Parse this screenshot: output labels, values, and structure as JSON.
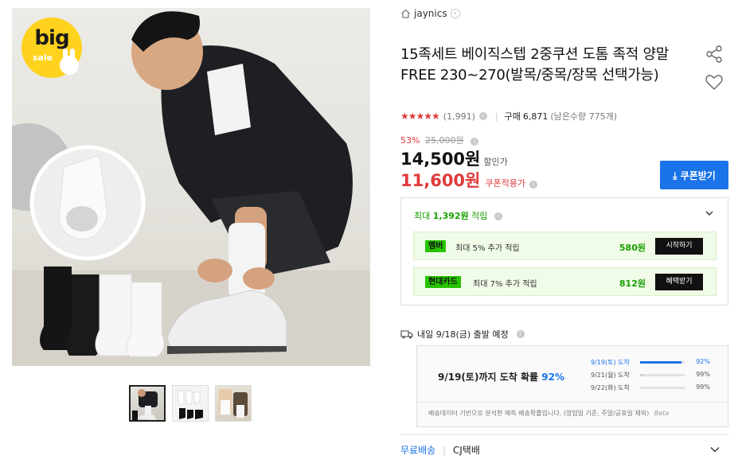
{
  "badge": {
    "line1": "big",
    "line2": "sale"
  },
  "seller": {
    "name": "jaynics"
  },
  "product": {
    "title": "15족세트 베이직스텝 2중쿠션 도톰 족적 양말 FREE 230~270(발목/중목/장목 선택가능)"
  },
  "rating": {
    "stars": "★★★★★",
    "review_count": "(1,991)",
    "purchase_label": "구매",
    "purchase_count": "6,871",
    "stock": "(남은수량 775개)"
  },
  "price": {
    "discount_rate": "53%",
    "original": "25,000원",
    "sale": "14,500원",
    "sale_label": "할인가",
    "coupon_price": "11,600원",
    "coupon_label": "쿠폰적용가",
    "coupon_button": "쿠폰받기"
  },
  "points": {
    "header_prefix": "최대",
    "header_value": "1,392원",
    "header_suffix": "적립",
    "rows": [
      {
        "tag": "멤버",
        "desc": "최대 5% 추가 적립",
        "amount": "580원",
        "action": "시작하기"
      },
      {
        "tag": "현대카드",
        "desc": "최대 7% 추가 적립",
        "amount": "812원",
        "action": "혜택받기"
      }
    ]
  },
  "shipping": {
    "header": "내일 9/18(금) 출발 예정",
    "probability_text": "9/19(토)까지 도착 확률",
    "probability_value": "92%",
    "distribution": [
      {
        "label": "9/19(토) 도착",
        "pct": "92%",
        "value": 0.92
      },
      {
        "label": "9/21(월) 도착",
        "pct": "99%",
        "value": 0.07
      },
      {
        "label": "9/22(화) 도착",
        "pct": "99%",
        "value": 0.0
      }
    ],
    "note": "배송데이터 기반으로 분석한 예측 배송확률입니다. (영업일 기준, 주말/공휴일 제외)",
    "beta": "Beta",
    "free_label": "무료배송",
    "carrier": "CJ택배"
  },
  "colors": {
    "accent_blue": "#1a73e8",
    "price_red": "#e03a3a",
    "point_green": "#18a000",
    "tag_green": "#27c400"
  },
  "icons": [
    "home-icon",
    "chevron-right-icon",
    "share-icon",
    "heart-icon",
    "info-icon",
    "download-icon",
    "chevron-down-icon",
    "truck-icon"
  ]
}
